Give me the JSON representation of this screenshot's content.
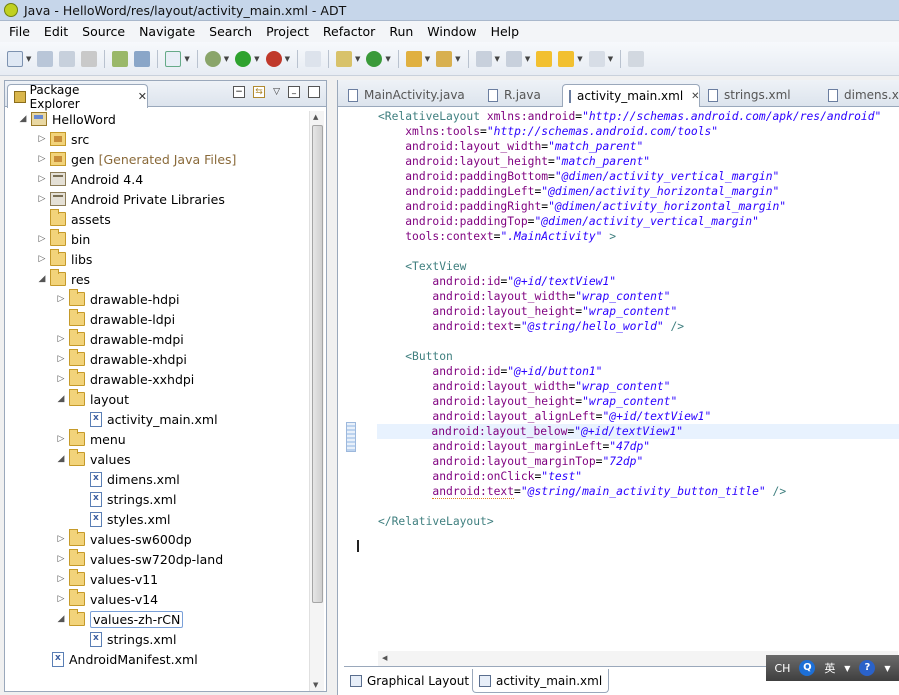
{
  "window": {
    "title": "Java - HelloWord/res/layout/activity_main.xml - ADT"
  },
  "menu": [
    "File",
    "Edit",
    "Source",
    "Navigate",
    "Search",
    "Project",
    "Refactor",
    "Run",
    "Window",
    "Help"
  ],
  "package_explorer": {
    "tab_label": "Package Explorer",
    "tree": [
      {
        "label": "HelloWord",
        "icon": "project-icon",
        "level": 0,
        "twisty": "open"
      },
      {
        "label": "src",
        "icon": "source-folder-icon",
        "level": 1,
        "twisty": "closed"
      },
      {
        "label": "gen",
        "suffix": "[Generated Java Files]",
        "icon": "source-folder-icon",
        "level": 1,
        "twisty": "closed"
      },
      {
        "label": "Android 4.4",
        "icon": "library-icon",
        "level": 1,
        "twisty": "closed"
      },
      {
        "label": "Android Private Libraries",
        "icon": "library-icon",
        "level": 1,
        "twisty": "closed"
      },
      {
        "label": "assets",
        "icon": "folder-icon",
        "level": 1,
        "twisty": "none"
      },
      {
        "label": "bin",
        "icon": "folder-icon",
        "level": 1,
        "twisty": "closed"
      },
      {
        "label": "libs",
        "icon": "folder-icon",
        "level": 1,
        "twisty": "closed"
      },
      {
        "label": "res",
        "icon": "folder-icon",
        "level": 1,
        "twisty": "open"
      },
      {
        "label": "drawable-hdpi",
        "icon": "folder-icon",
        "level": 2,
        "twisty": "closed"
      },
      {
        "label": "drawable-ldpi",
        "icon": "folder-icon",
        "level": 2,
        "twisty": "none"
      },
      {
        "label": "drawable-mdpi",
        "icon": "folder-icon",
        "level": 2,
        "twisty": "closed"
      },
      {
        "label": "drawable-xhdpi",
        "icon": "folder-icon",
        "level": 2,
        "twisty": "closed"
      },
      {
        "label": "drawable-xxhdpi",
        "icon": "folder-icon",
        "level": 2,
        "twisty": "closed"
      },
      {
        "label": "layout",
        "icon": "folder-icon",
        "level": 2,
        "twisty": "open"
      },
      {
        "label": "activity_main.xml",
        "icon": "xml-file-icon",
        "level": 3,
        "twisty": "none"
      },
      {
        "label": "menu",
        "icon": "folder-icon",
        "level": 2,
        "twisty": "closed"
      },
      {
        "label": "values",
        "icon": "folder-icon",
        "level": 2,
        "twisty": "open"
      },
      {
        "label": "dimens.xml",
        "icon": "xml-file-icon",
        "level": 3,
        "twisty": "none"
      },
      {
        "label": "strings.xml",
        "icon": "xml-file-icon",
        "level": 3,
        "twisty": "none"
      },
      {
        "label": "styles.xml",
        "icon": "xml-file-icon",
        "level": 3,
        "twisty": "none"
      },
      {
        "label": "values-sw600dp",
        "icon": "folder-icon",
        "level": 2,
        "twisty": "closed"
      },
      {
        "label": "values-sw720dp-land",
        "icon": "folder-icon",
        "level": 2,
        "twisty": "closed"
      },
      {
        "label": "values-v11",
        "icon": "folder-icon",
        "level": 2,
        "twisty": "closed"
      },
      {
        "label": "values-v14",
        "icon": "folder-icon",
        "level": 2,
        "twisty": "closed"
      },
      {
        "label": "values-zh-rCN",
        "icon": "folder-icon",
        "level": 2,
        "twisty": "open",
        "selected": true
      },
      {
        "label": "strings.xml",
        "icon": "xml-file-icon",
        "level": 3,
        "twisty": "none"
      },
      {
        "label": "AndroidManifest.xml",
        "icon": "xml-file-icon",
        "level": 1,
        "twisty": "none"
      }
    ]
  },
  "editor": {
    "tabs": [
      {
        "label": "MainActivity.java",
        "active": false
      },
      {
        "label": "R.java",
        "active": false
      },
      {
        "label": "activity_main.xml",
        "active": true
      },
      {
        "label": "strings.xml",
        "active": false
      },
      {
        "label": "dimens.xml",
        "active": false
      }
    ],
    "lines": [
      [
        [
          "tag",
          "<RelativeLayout "
        ],
        [
          "an",
          "xmlns:android"
        ],
        [
          "pn",
          "="
        ],
        [
          "av",
          "\"http://schemas.android.com/apk/res/android\""
        ]
      ],
      [
        [
          "pn",
          "    "
        ],
        [
          "an",
          "xmlns:tools"
        ],
        [
          "pn",
          "="
        ],
        [
          "av",
          "\"http://schemas.android.com/tools\""
        ]
      ],
      [
        [
          "pn",
          "    "
        ],
        [
          "an",
          "android:layout_width"
        ],
        [
          "pn",
          "="
        ],
        [
          "av",
          "\"match_parent\""
        ]
      ],
      [
        [
          "pn",
          "    "
        ],
        [
          "an",
          "android:layout_height"
        ],
        [
          "pn",
          "="
        ],
        [
          "av",
          "\"match_parent\""
        ]
      ],
      [
        [
          "pn",
          "    "
        ],
        [
          "an",
          "android:paddingBottom"
        ],
        [
          "pn",
          "="
        ],
        [
          "av",
          "\"@dimen/activity_vertical_margin\""
        ]
      ],
      [
        [
          "pn",
          "    "
        ],
        [
          "an",
          "android:paddingLeft"
        ],
        [
          "pn",
          "="
        ],
        [
          "av",
          "\"@dimen/activity_horizontal_margin\""
        ]
      ],
      [
        [
          "pn",
          "    "
        ],
        [
          "an",
          "android:paddingRight"
        ],
        [
          "pn",
          "="
        ],
        [
          "av",
          "\"@dimen/activity_horizontal_margin\""
        ]
      ],
      [
        [
          "pn",
          "    "
        ],
        [
          "an",
          "android:paddingTop"
        ],
        [
          "pn",
          "="
        ],
        [
          "av",
          "\"@dimen/activity_vertical_margin\""
        ]
      ],
      [
        [
          "pn",
          "    "
        ],
        [
          "an",
          "tools:context"
        ],
        [
          "pn",
          "="
        ],
        [
          "av",
          "\".MainActivity\""
        ],
        [
          "tag",
          " >"
        ]
      ],
      [],
      [
        [
          "pn",
          "    "
        ],
        [
          "tag",
          "<TextView"
        ]
      ],
      [
        [
          "pn",
          "        "
        ],
        [
          "an",
          "android:id"
        ],
        [
          "pn",
          "="
        ],
        [
          "av",
          "\"@+id/textView1\""
        ]
      ],
      [
        [
          "pn",
          "        "
        ],
        [
          "an",
          "android:layout_width"
        ],
        [
          "pn",
          "="
        ],
        [
          "av",
          "\"wrap_content\""
        ]
      ],
      [
        [
          "pn",
          "        "
        ],
        [
          "an",
          "android:layout_height"
        ],
        [
          "pn",
          "="
        ],
        [
          "av",
          "\"wrap_content\""
        ]
      ],
      [
        [
          "pn",
          "        "
        ],
        [
          "an",
          "android:text"
        ],
        [
          "pn",
          "="
        ],
        [
          "av",
          "\"@string/hello_world\""
        ],
        [
          "tag",
          " />"
        ]
      ],
      [],
      [
        [
          "pn",
          "    "
        ],
        [
          "tag",
          "<Button"
        ]
      ],
      [
        [
          "pn",
          "        "
        ],
        [
          "an",
          "android:id"
        ],
        [
          "pn",
          "="
        ],
        [
          "av",
          "\"@+id/button1\""
        ]
      ],
      [
        [
          "pn",
          "        "
        ],
        [
          "an",
          "android:layout_width"
        ],
        [
          "pn",
          "="
        ],
        [
          "av",
          "\"wrap_content\""
        ]
      ],
      [
        [
          "pn",
          "        "
        ],
        [
          "an",
          "android:layout_height"
        ],
        [
          "pn",
          "="
        ],
        [
          "av",
          "\"wrap_content\""
        ]
      ],
      [
        [
          "pn",
          "        "
        ],
        [
          "an",
          "android:layout_alignLeft"
        ],
        [
          "pn",
          "="
        ],
        [
          "av",
          "\"@+id/textView1\""
        ]
      ],
      [
        [
          "pn",
          "        "
        ],
        [
          "an",
          "android:layout_below"
        ],
        [
          "pn",
          "="
        ],
        [
          "av",
          "\"@+id/textView1\""
        ]
      ],
      [
        [
          "pn",
          "        "
        ],
        [
          "an",
          "android:layout_marginLeft"
        ],
        [
          "pn",
          "="
        ],
        [
          "av",
          "\"47dp\""
        ]
      ],
      [
        [
          "pn",
          "        "
        ],
        [
          "an",
          "android:layout_marginTop"
        ],
        [
          "pn",
          "="
        ],
        [
          "av",
          "\"72dp\""
        ]
      ],
      [
        [
          "pn",
          "        "
        ],
        [
          "an",
          "android:onClick"
        ],
        [
          "pn",
          "="
        ],
        [
          "av",
          "\"test\""
        ]
      ],
      [
        [
          "pn",
          "        "
        ],
        [
          "an",
          "android:text"
        ],
        [
          "pn",
          "="
        ],
        [
          "av",
          "\"@string/main_activity_button_title\""
        ],
        [
          "tag",
          " />"
        ]
      ],
      [],
      [
        [
          "tag",
          "</RelativeLayout>"
        ]
      ]
    ],
    "highlighted_line": 21,
    "bottom_tabs": [
      {
        "label": "Graphical Layout",
        "active": false
      },
      {
        "label": "activity_main.xml",
        "active": true
      }
    ]
  },
  "ime": {
    "mode": "CH",
    "lang": "英"
  }
}
